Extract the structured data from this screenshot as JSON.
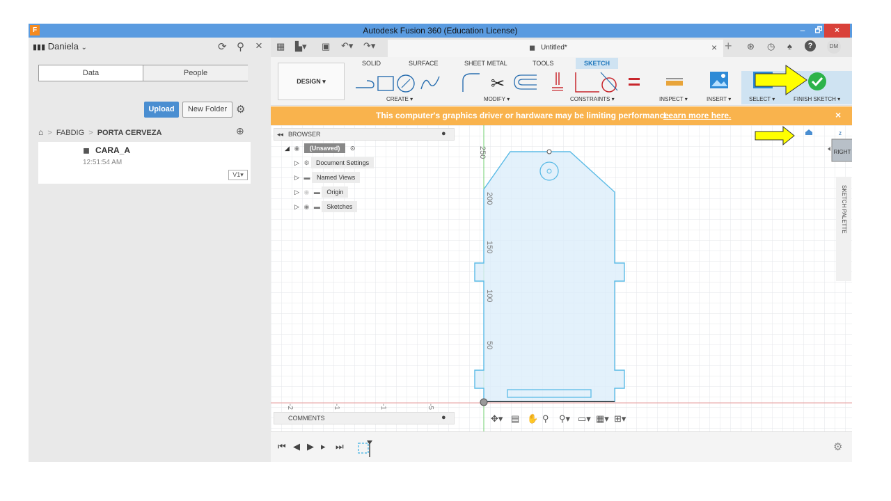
{
  "window": {
    "title": "Autodesk Fusion 360 (Education License)",
    "app_icon": "F",
    "minimize": "–",
    "restore": "🗗",
    "close": "×"
  },
  "left_panel": {
    "user": "Daniela",
    "tabs": [
      "Data",
      "People"
    ],
    "upload_label": "Upload",
    "new_folder_label": "New Folder",
    "breadcrumb": [
      "FABDIG",
      "PORTA CERVEZA"
    ],
    "file": {
      "name": "CARA_A",
      "time": "12:51:54 AM",
      "version": "V1"
    }
  },
  "header": {
    "doc_title": "Untitled*",
    "user_initials": "DM"
  },
  "toolbar": {
    "design_label": "DESIGN",
    "tabs": [
      "SOLID",
      "SURFACE",
      "SHEET METAL",
      "TOOLS",
      "SKETCH"
    ],
    "active_tab": "SKETCH",
    "groups": [
      "CREATE",
      "MODIFY",
      "CONSTRAINTS",
      "INSPECT",
      "INSERT",
      "SELECT",
      "FINISH SKETCH"
    ]
  },
  "warning": {
    "text": "This computer's graphics driver or hardware may be limiting performance.",
    "link": "Learn more here."
  },
  "browser": {
    "title": "BROWSER",
    "root": "(Unsaved)",
    "items": [
      "Document Settings",
      "Named Views",
      "Origin",
      "Sketches"
    ]
  },
  "canvas": {
    "y_ticks": [
      "250",
      "200",
      "150",
      "100",
      "50"
    ],
    "x_ticks": [
      "-2",
      "-1",
      "-1",
      "-5"
    ],
    "viewcube_label": "RIGHT",
    "sketch_palette": "SKETCH PALETTE"
  },
  "comments": {
    "title": "COMMENTS"
  },
  "colors": {
    "accent": "#4a8ed1",
    "warning": "#f9b34d",
    "sketch_line": "#5bbbe6",
    "highlight": "#ffff00",
    "finish_green": "#2db34a"
  }
}
